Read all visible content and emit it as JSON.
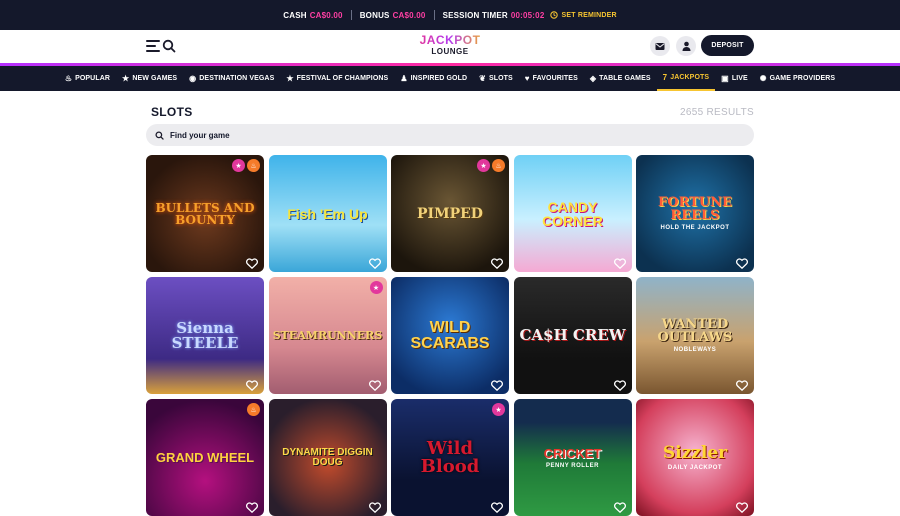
{
  "status": {
    "cash_label": "CASH",
    "cash_value": "CA$0.00",
    "bonus_label": "BONUS",
    "bonus_value": "CA$0.00",
    "timer_label": "SESSION TIMER",
    "timer_value": "00:05:02",
    "reminder_label": "SET REMINDER"
  },
  "header": {
    "logo_line1": "JACKPOT",
    "logo_line2": "LOUNGE",
    "deposit_label": "DEPOSIT"
  },
  "nav": {
    "items": [
      {
        "label": "POPULAR",
        "icon": "fire-icon"
      },
      {
        "label": "NEW GAMES",
        "icon": "star-icon"
      },
      {
        "label": "DESTINATION VEGAS",
        "icon": "pin-icon"
      },
      {
        "label": "FESTIVAL OF CHAMPIONS",
        "icon": "star-icon"
      },
      {
        "label": "INSPIRED GOLD",
        "icon": "person-icon"
      },
      {
        "label": "SLOTS",
        "icon": "cherries-icon"
      },
      {
        "label": "FAVOURITES",
        "icon": "heart-icon"
      },
      {
        "label": "TABLE GAMES",
        "icon": "chips-icon"
      },
      {
        "label": "JACKPOTS",
        "icon": "seven-icon"
      },
      {
        "label": "LIVE",
        "icon": "live-icon"
      },
      {
        "label": "GAME PROVIDERS",
        "icon": "gear-icon"
      }
    ],
    "active": "JACKPOTS"
  },
  "main": {
    "title": "SLOTS",
    "results": "2655 RESULTS",
    "search_placeholder": "Find your game"
  },
  "games": [
    {
      "title": "BULLETS AND BOUNTY",
      "badges": [
        "star",
        "fire"
      ]
    },
    {
      "title": "Fish 'Em Up",
      "badges": []
    },
    {
      "title": "PIMPED",
      "badges": [
        "star",
        "fire"
      ]
    },
    {
      "title": "CANDY CORNER",
      "badges": []
    },
    {
      "title": "FORTUNE REELS",
      "subtitle": "HOLD THE JACKPOT",
      "badges": []
    },
    {
      "title": "Sienna STEELE",
      "badges": []
    },
    {
      "title": "STEAMRUNNERS",
      "badges": [
        "star"
      ]
    },
    {
      "title": "WILD SCARABS",
      "badges": []
    },
    {
      "title": "CA$H CREW",
      "badges": []
    },
    {
      "title": "WANTED OUTLAWS",
      "subtitle": "NOBLEWAYS",
      "badges": []
    },
    {
      "title": "GRAND WHEEL",
      "badges": [
        "fire"
      ]
    },
    {
      "title": "DYNAMITE DIGGIN DOUG",
      "badges": []
    },
    {
      "title": "Wild Blood",
      "badges": [
        "star"
      ]
    },
    {
      "title": "CRICKET",
      "subtitle": "PENNY ROLLER",
      "badges": []
    },
    {
      "title": "Sizzler",
      "subtitle": "DAILY JACKPOT",
      "badges": []
    }
  ],
  "colors": {
    "dark": "#14182b",
    "accent_pink": "#ff3fa4",
    "accent_gold": "#f7c531"
  }
}
